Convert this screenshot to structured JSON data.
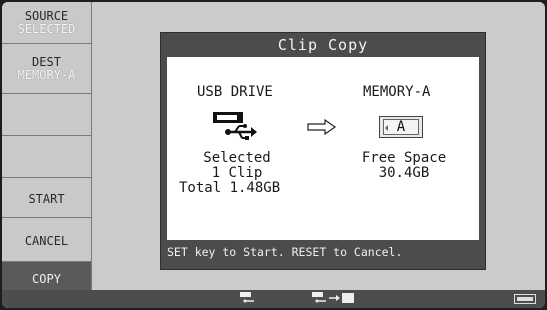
{
  "sidebar": {
    "source": {
      "line1": "SOURCE",
      "line2": "SELECTED"
    },
    "dest": {
      "line1": "DEST",
      "line2": "MEMORY-A"
    },
    "start": "START",
    "cancel": "CANCEL",
    "copy": "COPY"
  },
  "dialog": {
    "title": "Clip Copy",
    "source_name": "USB DRIVE",
    "dest_name": "MEMORY-A",
    "card_label": "A",
    "source_status": "Selected",
    "clip_count": "1 Clip",
    "total": "Total 1.48GB",
    "free_label": "Free Space",
    "free_value": "30.4GB",
    "instruction": "SET key to Start. RESET to Cancel."
  },
  "icons": {
    "usb": "usb-drive-icon",
    "arrow": "arrow-right-icon",
    "card": "memory-card-icon"
  },
  "colors": {
    "dialog_bg": "#4c4c4c",
    "screen_bg": "#c9c9c9",
    "panel_bg": "#ffffff"
  }
}
